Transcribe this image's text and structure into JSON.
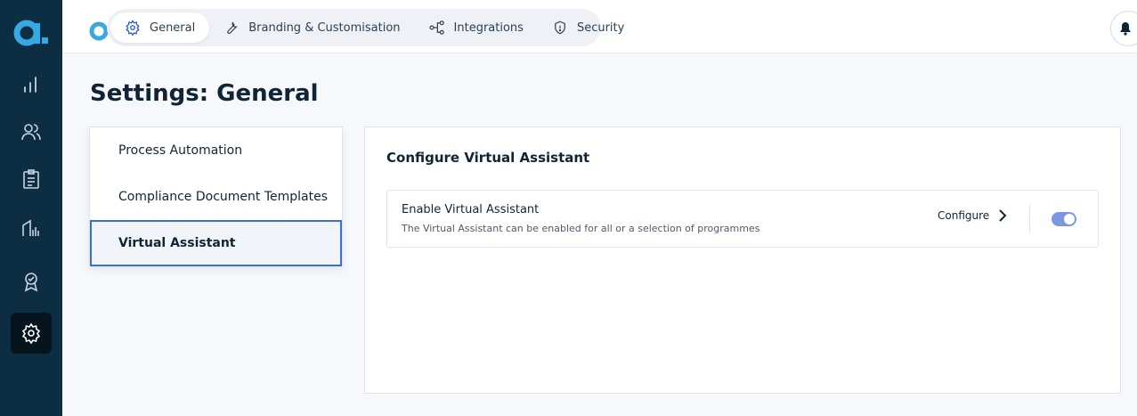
{
  "brand": {
    "logo_letter": "a",
    "accent": "#36a9e1",
    "rail_bg": "#0d2d42"
  },
  "rail": {
    "items": [
      {
        "icon": "bar-chart-icon"
      },
      {
        "icon": "users-icon"
      },
      {
        "icon": "clipboard-icon"
      },
      {
        "icon": "report-icon"
      },
      {
        "icon": "badge-icon"
      },
      {
        "icon": "gear-icon",
        "active": true
      }
    ]
  },
  "tabs": [
    {
      "label": "General",
      "icon": "gear-icon",
      "active": true
    },
    {
      "label": "Branding & Customisation",
      "icon": "wrench-icon"
    },
    {
      "label": "Integrations",
      "icon": "integrations-icon"
    },
    {
      "label": "Security",
      "icon": "shield-icon"
    }
  ],
  "page": {
    "title_strong": "Settings:",
    "title_rest": " General"
  },
  "menu": [
    {
      "label": "Process Automation"
    },
    {
      "label": "Compliance Document Templates"
    },
    {
      "label": "Virtual Assistant",
      "active": true
    }
  ],
  "panel": {
    "title": "Configure Virtual Assistant",
    "card": {
      "title": "Enable Virtual Assistant",
      "description": "The Virtual Assistant can be enabled for all or a selection of programmes",
      "configure_label": "Configure",
      "enabled": true
    }
  }
}
